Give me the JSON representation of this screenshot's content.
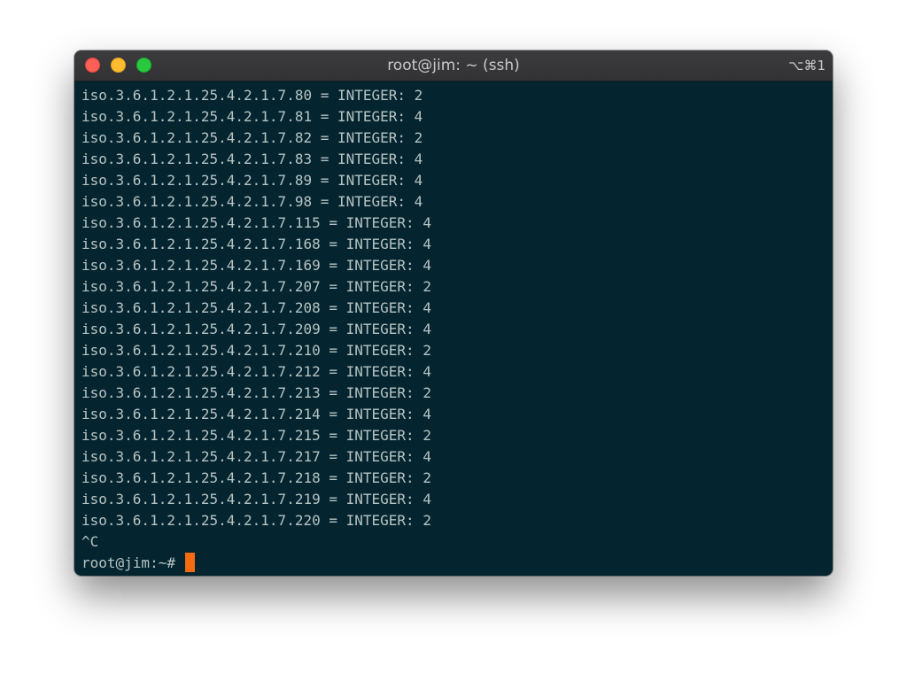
{
  "window": {
    "title": "root@jim: ~ (ssh)",
    "shortcut": "⌥⌘1"
  },
  "terminal": {
    "lines": [
      "iso.3.6.1.2.1.25.4.2.1.7.80 = INTEGER: 2",
      "iso.3.6.1.2.1.25.4.2.1.7.81 = INTEGER: 4",
      "iso.3.6.1.2.1.25.4.2.1.7.82 = INTEGER: 2",
      "iso.3.6.1.2.1.25.4.2.1.7.83 = INTEGER: 4",
      "iso.3.6.1.2.1.25.4.2.1.7.89 = INTEGER: 4",
      "iso.3.6.1.2.1.25.4.2.1.7.98 = INTEGER: 4",
      "iso.3.6.1.2.1.25.4.2.1.7.115 = INTEGER: 4",
      "iso.3.6.1.2.1.25.4.2.1.7.168 = INTEGER: 4",
      "iso.3.6.1.2.1.25.4.2.1.7.169 = INTEGER: 4",
      "iso.3.6.1.2.1.25.4.2.1.7.207 = INTEGER: 2",
      "iso.3.6.1.2.1.25.4.2.1.7.208 = INTEGER: 4",
      "iso.3.6.1.2.1.25.4.2.1.7.209 = INTEGER: 4",
      "iso.3.6.1.2.1.25.4.2.1.7.210 = INTEGER: 2",
      "iso.3.6.1.2.1.25.4.2.1.7.212 = INTEGER: 4",
      "iso.3.6.1.2.1.25.4.2.1.7.213 = INTEGER: 2",
      "iso.3.6.1.2.1.25.4.2.1.7.214 = INTEGER: 4",
      "iso.3.6.1.2.1.25.4.2.1.7.215 = INTEGER: 2",
      "iso.3.6.1.2.1.25.4.2.1.7.217 = INTEGER: 4",
      "iso.3.6.1.2.1.25.4.2.1.7.218 = INTEGER: 2",
      "iso.3.6.1.2.1.25.4.2.1.7.219 = INTEGER: 4",
      "iso.3.6.1.2.1.25.4.2.1.7.220 = INTEGER: 2",
      "^C"
    ],
    "prompt": "root@jim:~# ",
    "colors": {
      "background": "#042530",
      "foreground": "#b7c3c2",
      "cursor": "#f36b11"
    }
  }
}
